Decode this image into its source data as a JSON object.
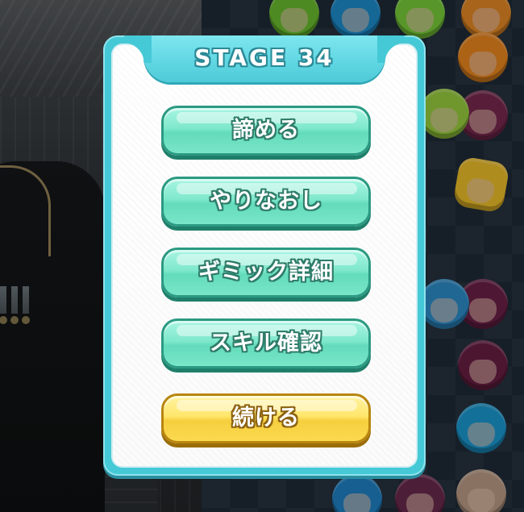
{
  "dialog": {
    "title": "STAGE 34",
    "buttons": {
      "give_up": "諦める",
      "retry": "やりなおし",
      "gimmick_details": "ギミック詳細",
      "skill_check": "スキル確認",
      "continue": "続ける"
    }
  },
  "colors": {
    "frame": "#45c9d6",
    "mint_button": "#7fe8cc",
    "yellow_button": "#ffe66a"
  }
}
